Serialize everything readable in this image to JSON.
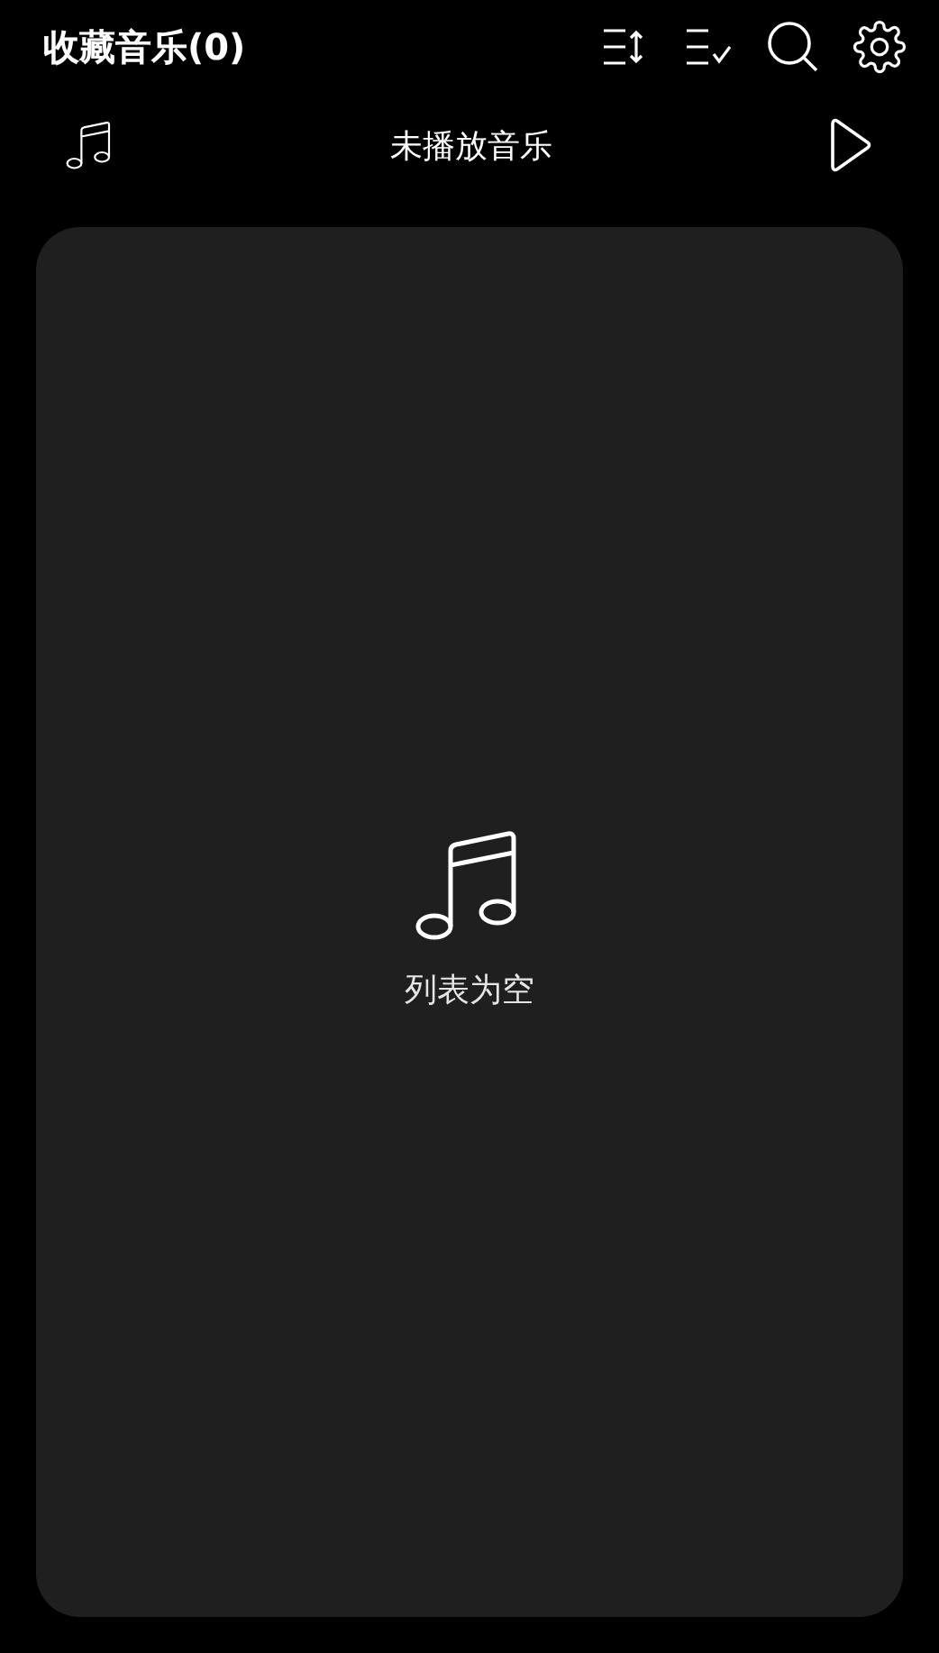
{
  "header": {
    "title": "收藏音乐(0)"
  },
  "toolbar": [
    {
      "kind": "sort"
    },
    {
      "kind": "select"
    },
    {
      "kind": "search"
    },
    {
      "kind": "settings"
    }
  ],
  "player": {
    "status": "未播放音乐"
  },
  "list": {
    "empty_message": "列表为空"
  }
}
